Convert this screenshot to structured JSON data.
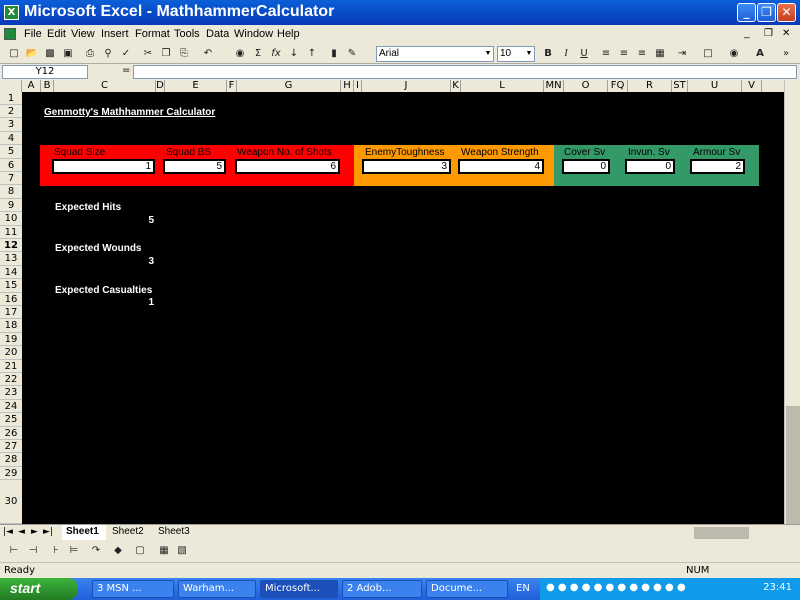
{
  "window": {
    "title": "Microsoft Excel - MathhammerCalculator",
    "app_icon": "X",
    "min": "_",
    "max": "❐",
    "close": "✕"
  },
  "menubar": {
    "items": [
      "File",
      "Edit",
      "View",
      "Insert",
      "Format",
      "Tools",
      "Data",
      "Window",
      "Help"
    ],
    "win_min": "_",
    "win_restore": "❐",
    "win_close": "✕"
  },
  "toolbar": {
    "font": "Arial",
    "size": "10",
    "bold": "B",
    "italic": "I",
    "underline": "U",
    "sum": "Σ",
    "fx": "fx"
  },
  "formula_bar": {
    "cell_ref": "Y12",
    "eq": "=",
    "value": ""
  },
  "columns": [
    "A",
    "B",
    "C",
    "D",
    "E",
    "F",
    "G",
    "H",
    "I",
    "J",
    "K",
    "L",
    "MN",
    "O",
    "FQ",
    "R",
    "ST",
    "U",
    "V"
  ],
  "rows": [
    "1",
    "2",
    "3",
    "4",
    "5",
    "6",
    "7",
    "8",
    "9",
    "10",
    "11",
    "12",
    "13",
    "14",
    "15",
    "16",
    "17",
    "18",
    "19",
    "20",
    "21",
    "22",
    "23",
    "24",
    "25",
    "26",
    "27",
    "28",
    "29",
    "30"
  ],
  "sheet": {
    "title": "Genmotty's Mathhammer Calculator",
    "colors": {
      "red": "#ff0000",
      "orange": "#ff9900",
      "green": "#339966",
      "text_red": "#ff0000",
      "text_black": "#000000"
    },
    "inputs": {
      "squad_size": {
        "label": "Squad Size",
        "value": "1"
      },
      "squad_bs": {
        "label": "Squad BS",
        "value": "5"
      },
      "weapon_shots": {
        "label": "Weapon No. of Shots",
        "value": "6"
      },
      "enemy_toughness": {
        "label": "EnemyToughness",
        "value": "3"
      },
      "weapon_strength": {
        "label": "Weapon Strength",
        "value": "4"
      },
      "cover_sv": {
        "label": "Cover Sv",
        "value": "0"
      },
      "invun_sv": {
        "label": "Invun. Sv",
        "value": "0"
      },
      "armour_sv": {
        "label": "Armour Sv",
        "value": "2"
      }
    },
    "results": {
      "hits": {
        "label": "Expected Hits",
        "value": "5"
      },
      "wounds": {
        "label": "Expected Wounds",
        "value": "3"
      },
      "casualties": {
        "label": "Expected Casualties",
        "value": "1"
      }
    }
  },
  "tabs": {
    "nav": [
      "|◄",
      "◄",
      "►",
      "►|"
    ],
    "sheets": [
      "Sheet1",
      "Sheet2",
      "Sheet3"
    ]
  },
  "status": {
    "left": "Ready",
    "num": "NUM"
  },
  "taskbar": {
    "start": "start",
    "tasks": [
      "3 MSN ...",
      "Warham...",
      "Microsoft...",
      "2 Adob...",
      "Docume..."
    ],
    "lang": "EN",
    "clock": "23:41"
  }
}
